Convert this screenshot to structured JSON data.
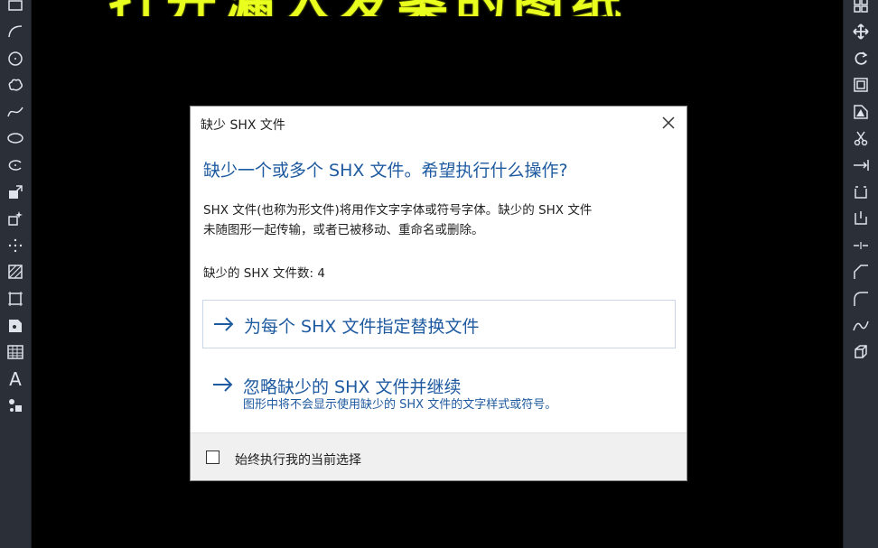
{
  "banner": {
    "text": "打开漏入发案的图纸"
  },
  "dialog": {
    "title": "缺少 SHX 文件",
    "headline": "缺少一个或多个 SHX 文件。希望执行什么操作?",
    "description_line1": "SHX 文件(也称为形文件)将用作文字字体或符号字体。缺少的 SHX 文件",
    "description_line2": "未随图形一起传输，或者已被移动、重命名或删除。",
    "count_label": "缺少的 SHX 文件数: 4",
    "option_replace": "为每个 SHX 文件指定替换文件",
    "option_ignore": "忽略缺少的 SHX 文件并继续",
    "option_ignore_sub": "图形中将不会显示使用缺少的 SHX 文件的文字样式或符号。",
    "always_label": "始终执行我的当前选择",
    "always_checked": false
  },
  "toolbar_left": {
    "icons": [
      "rectangle-icon",
      "arc-icon",
      "circle-icon",
      "revcloud-icon",
      "spline-icon",
      "ellipse-icon",
      "ellipse-arc-icon",
      "insert-block-icon",
      "make-block-icon",
      "point-icon",
      "hatch-icon",
      "gradient-icon",
      "region-icon",
      "table-icon",
      "mtext-icon",
      "add-selected-icon"
    ],
    "mtext_glyph": "A"
  },
  "toolbar_right": {
    "icons": [
      "copy-icon",
      "move-icon",
      "rotate-icon",
      "offset-icon",
      "mirror-icon",
      "trim-icon",
      "extend-icon",
      "break-icon",
      "break-at-point-icon",
      "join-icon",
      "chamfer-icon",
      "fillet-icon",
      "blend-icon",
      "explode-icon",
      "array-icon"
    ]
  },
  "colors": {
    "accent": "#1e5aa0",
    "banner": "#e9ff1d",
    "toolbar": "#2b3038",
    "background": "#000000"
  }
}
